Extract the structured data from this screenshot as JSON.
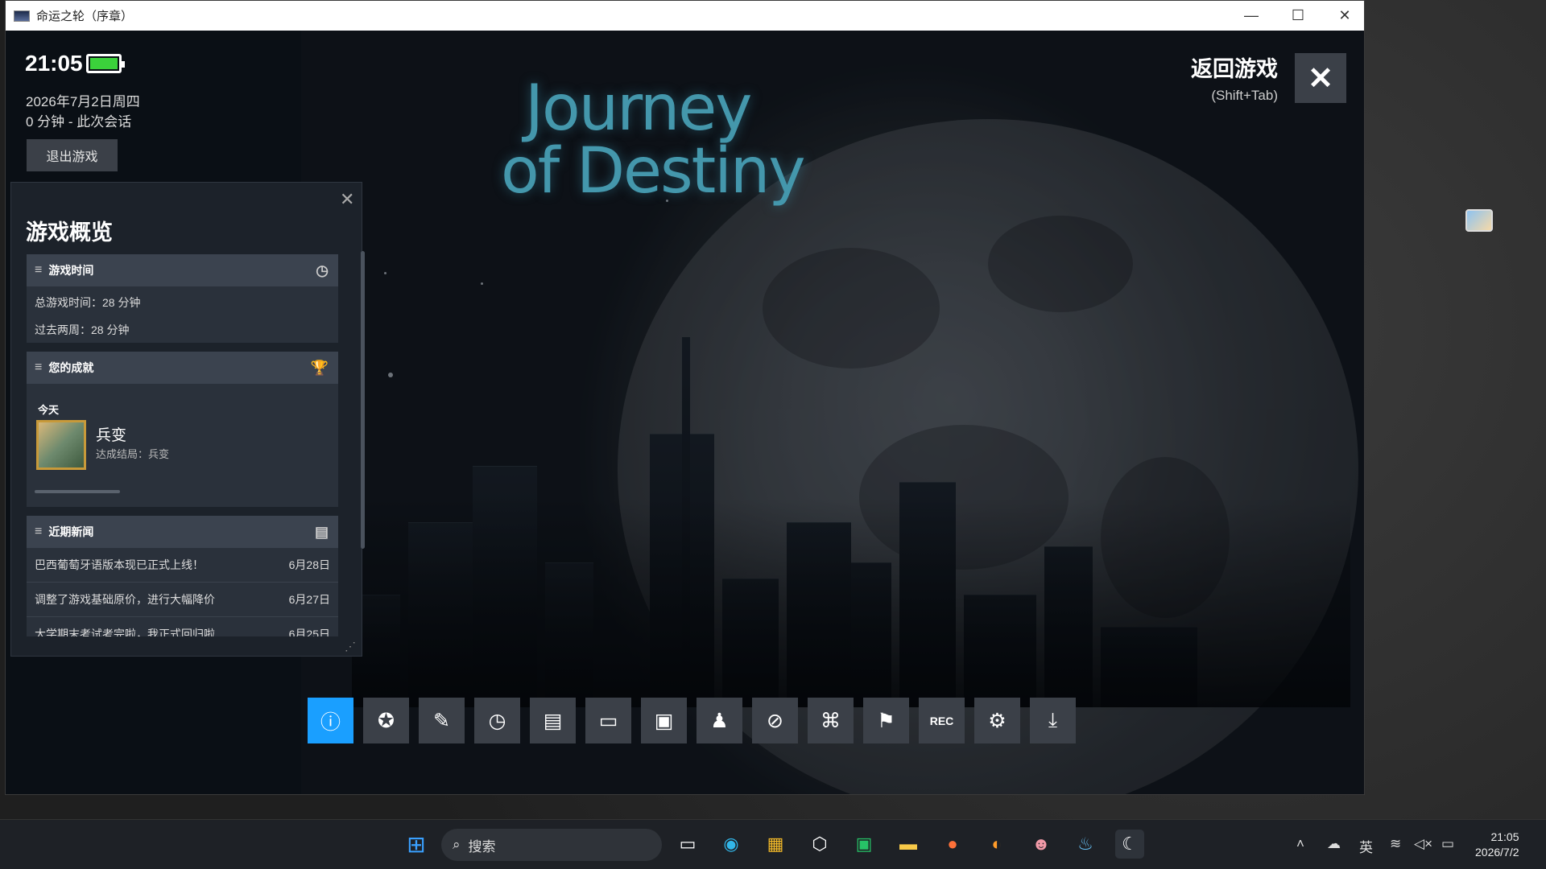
{
  "window": {
    "title": "命运之轮（序章）",
    "min": "—",
    "max": "☐",
    "close": "✕"
  },
  "game": {
    "logo_line1": "Journey",
    "logo_line2": "of Destiny"
  },
  "overlay": {
    "time": "21:05",
    "date": "2026年7月2日周四",
    "session": "0 分钟 - 此次会话",
    "exit": "退出游戏",
    "return_title": "返回游戏",
    "return_shortcut": "(Shift+Tab)",
    "close_icon": "✕",
    "battery_level": 1.0
  },
  "panel": {
    "close": "✕",
    "title": "游戏概览",
    "playtime": {
      "header": "游戏时间",
      "total": "总游戏时间：28 分钟",
      "recent": "过去两周：28 分钟"
    },
    "achievements": {
      "header": "您的成就",
      "day": "今天",
      "name": "兵变",
      "desc": "达成结局：兵变"
    },
    "news": {
      "header": "近期新闻",
      "items": [
        {
          "title": "巴西葡萄牙语版本现已正式上线！",
          "date": "6月28日"
        },
        {
          "title": "调整了游戏基础原价，进行大幅降价",
          "date": "6月27日"
        },
        {
          "title": "大学期末考试考完啦，我正式回归啦",
          "date": "6月25日"
        }
      ]
    }
  },
  "toolbar": [
    "ⓘ",
    "✪",
    "✎",
    "◷",
    "▤",
    "▭",
    "▣",
    "♟",
    "⊘",
    "⌘",
    "⚑",
    "REC",
    "⚙",
    "⤓"
  ],
  "taskbar": {
    "search": "搜索",
    "tray_lang": "英",
    "clock_time": "21:05",
    "clock_date": "2026/7/2"
  }
}
